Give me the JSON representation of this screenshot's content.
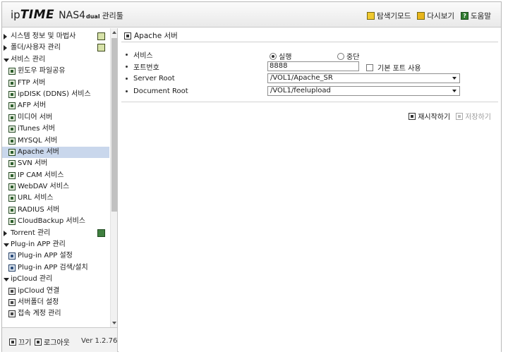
{
  "header": {
    "logo_ip": "ip",
    "logo_time": "TIME",
    "model": "NAS4",
    "model_suffix": "dual",
    "manager_label": "관리툴",
    "links": [
      {
        "label": "탐색기모드",
        "icon": "explorer-icon"
      },
      {
        "label": "다시보기",
        "icon": "refresh-icon"
      },
      {
        "label": "도움말",
        "icon": "help-icon"
      }
    ]
  },
  "sidebar": {
    "items": [
      {
        "label": "시스템 정보 및 마법사",
        "level": "top",
        "arrow": "right"
      },
      {
        "label": "폴더/사용자 관리",
        "level": "top",
        "arrow": "right"
      },
      {
        "label": "서비스 관리",
        "level": "top",
        "arrow": "down"
      },
      {
        "label": "윈도우 파일공유",
        "level": "sub"
      },
      {
        "label": "FTP 서버",
        "level": "sub"
      },
      {
        "label": "ipDISK (DDNS) 서비스",
        "level": "sub"
      },
      {
        "label": "AFP 서버",
        "level": "sub"
      },
      {
        "label": "미디어 서버",
        "level": "sub"
      },
      {
        "label": "iTunes 서버",
        "level": "sub"
      },
      {
        "label": "MYSQL 서버",
        "level": "sub"
      },
      {
        "label": "Apache 서버",
        "level": "sub",
        "selected": true
      },
      {
        "label": "SVN 서버",
        "level": "sub"
      },
      {
        "label": "IP CAM 서비스",
        "level": "sub"
      },
      {
        "label": "WebDAV 서비스",
        "level": "sub"
      },
      {
        "label": "URL 서비스",
        "level": "sub"
      },
      {
        "label": "RADIUS 서버",
        "level": "sub"
      },
      {
        "label": "CloudBackup 서비스",
        "level": "sub"
      },
      {
        "label": "Torrent 관리",
        "level": "top",
        "arrow": "right"
      },
      {
        "label": "Plug-in APP 관리",
        "level": "top",
        "arrow": "down"
      },
      {
        "label": "Plug-in APP 설정",
        "level": "sub"
      },
      {
        "label": "Plug-in APP 검색/설치",
        "level": "sub"
      },
      {
        "label": "ipCloud 관리",
        "level": "top",
        "arrow": "down"
      },
      {
        "label": "ipCloud 연결",
        "level": "sub"
      },
      {
        "label": "서버폴더 설정",
        "level": "sub"
      },
      {
        "label": "접속 계정 관리",
        "level": "sub"
      }
    ],
    "logout_off_label": "끄기",
    "logout_label": "로그아웃",
    "version": "Ver 1.2.76"
  },
  "main": {
    "title": "Apache 서버",
    "service_label": "서비스",
    "run_label": "실행",
    "stop_label": "중단",
    "service_state": "실행",
    "port_label": "포트번호",
    "port_value": "8888",
    "default_port_label": "기본 포트 사용",
    "server_root_label": "Server Root",
    "server_root_value": "/VOL1/Apache_SR",
    "document_root_label": "Document Root",
    "document_root_value": "/VOL1/feelupload",
    "restart_label": "재시작하기",
    "save_label": "저장하기"
  }
}
